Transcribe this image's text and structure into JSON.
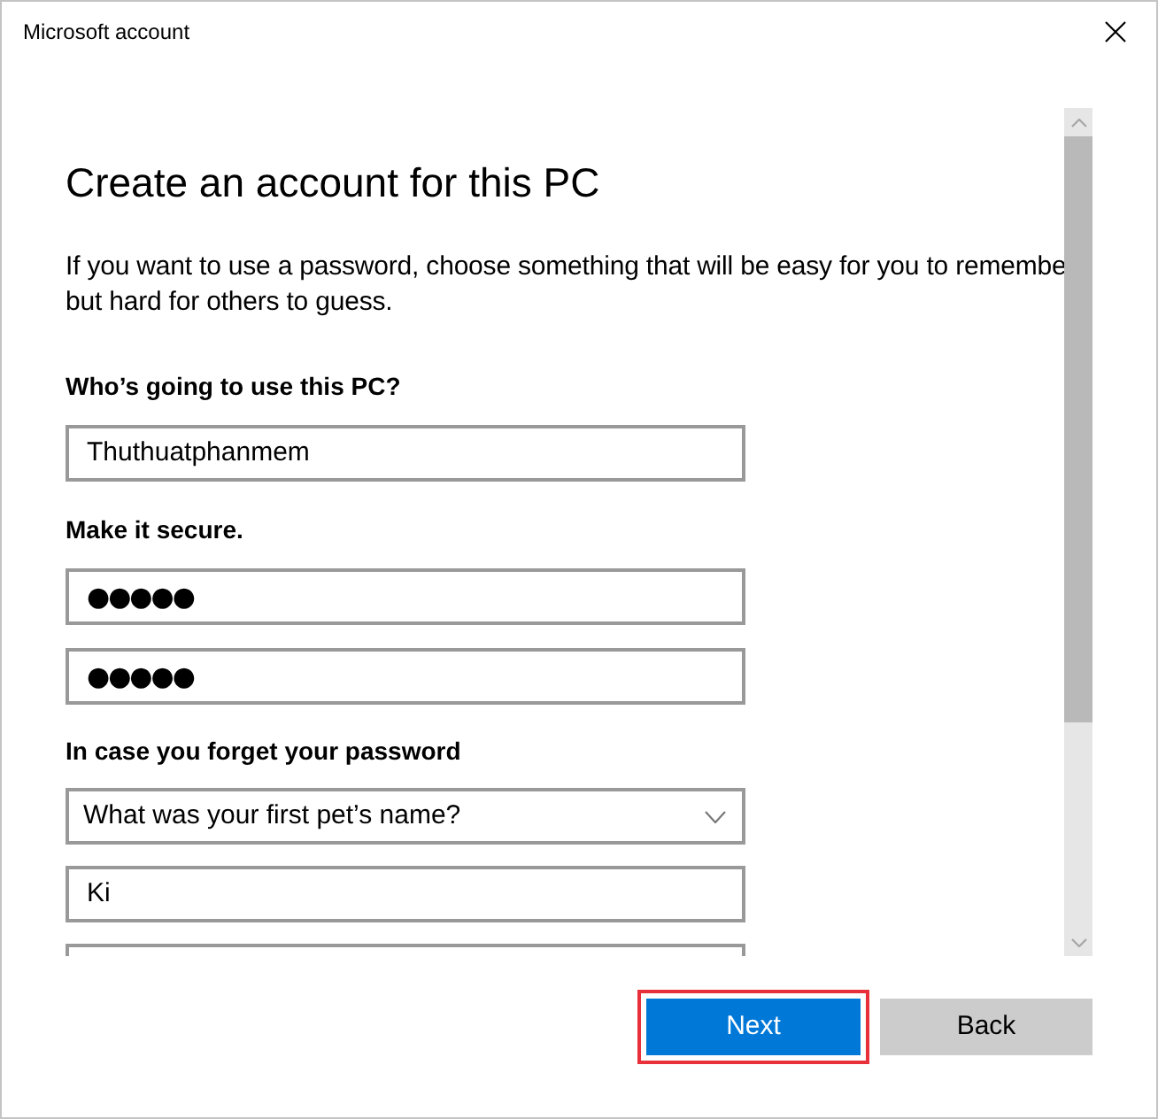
{
  "window": {
    "title": "Microsoft account"
  },
  "page": {
    "heading": "Create an account for this PC",
    "intro_lines": [
      "If you want to use a password, choose something that will be easy for you to remembe",
      "but hard for others to guess."
    ]
  },
  "sections": [
    {
      "label": "Who’s going to use this PC?",
      "fields": [
        {
          "kind": "text",
          "value": "Thuthuatphanmem"
        }
      ]
    },
    {
      "label": "Make it secure.",
      "fields": [
        {
          "kind": "password",
          "value": "●●●●●"
        },
        {
          "kind": "password",
          "value": "●●●●●"
        }
      ]
    },
    {
      "label": "In case you forget your password",
      "fields": [
        {
          "kind": "dropdown",
          "placeholder": "What was your first pet’s name?"
        },
        {
          "kind": "text",
          "value": "Ki"
        },
        {
          "kind": "text"
        }
      ]
    }
  ],
  "buttons": [
    {
      "label": "Next",
      "primary": true,
      "highlighted": true
    },
    {
      "label": "Back",
      "primary": false,
      "highlighted": false
    }
  ]
}
